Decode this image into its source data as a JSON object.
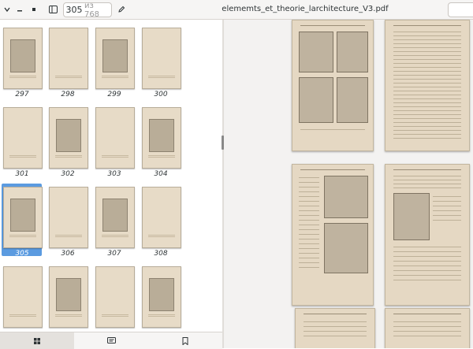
{
  "header": {
    "page_current": "305",
    "page_of": "из 768",
    "title": "elememts_et_theorie_larchitecture_V3.pdf",
    "icons": [
      "chevron-down-icon",
      "minimize-icon",
      "maximize-icon",
      "sidebar-toggle-icon",
      "pencil-icon"
    ]
  },
  "sidebar": {
    "thumbnails": [
      "297",
      "298",
      "299",
      "300",
      "301",
      "302",
      "303",
      "304",
      "305",
      "306",
      "307",
      "308",
      "",
      "",
      "",
      ""
    ],
    "selected_page": "305"
  },
  "bottom_bar": {
    "tabs": [
      "thumbnails-grid-icon",
      "annotations-icon",
      "bookmarks-icon"
    ],
    "active_tab": "thumbnails-grid-icon"
  },
  "colors": {
    "accent": "#5b9be0",
    "paper": "#e5d8c3",
    "toolbar": "#f6f5f4"
  }
}
